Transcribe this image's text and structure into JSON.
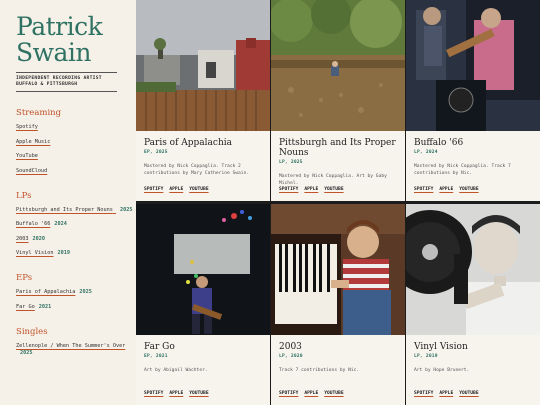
{
  "artist": {
    "name_line1": "Patrick",
    "name_line2": "Swain",
    "tagline_line1": "INDEPENDENT RECORDING ARTIST",
    "tagline_line2": "BUFFALO & PITTSBURGH"
  },
  "sidebar": {
    "streaming": {
      "heading": "Streaming",
      "links": [
        "Spotify",
        "Apple Music",
        "YouTube",
        "SoundCloud"
      ]
    },
    "lps": {
      "heading": "LPs",
      "items": [
        {
          "title": "Pittsburgh and Its Proper Nouns",
          "year": "2025"
        },
        {
          "title": "Buffalo '66",
          "year": "2024"
        },
        {
          "title": "2003",
          "year": "2020"
        },
        {
          "title": "Vinyl Vision",
          "year": "2019"
        }
      ]
    },
    "eps": {
      "heading": "EPs",
      "items": [
        {
          "title": "Paris of Appalachia",
          "year": "2025"
        },
        {
          "title": "Far Go",
          "year": "2021"
        }
      ]
    },
    "singles": {
      "heading": "Singles",
      "items": [
        {
          "title": "Zellenople / When The Summer's Over",
          "year": "2025"
        }
      ]
    }
  },
  "cards": [
    {
      "title": "Paris of Appalachia",
      "meta": "EP, 2025",
      "desc": "Mastered by Nick Coppaglia. Track 2 contributions by Mary Catherine Swain.",
      "links": [
        "SPOTIFY",
        "APPLE",
        "YOUTUBE"
      ]
    },
    {
      "title": "Pittsburgh and Its Proper Nouns",
      "meta": "LP, 2025",
      "desc": "Mastered by Nick Coppaglia. Art by Gaby Michel.",
      "links": [
        "SPOTIFY",
        "APPLE",
        "YOUTUBE"
      ]
    },
    {
      "title": "Buffalo '66",
      "meta": "LP, 2024",
      "desc": "Mastered by Nick Coppaglia. Track 7 contributions by Nic.",
      "links": [
        "SPOTIFY",
        "APPLE",
        "YOUTUBE"
      ]
    },
    {
      "title": "Far Go",
      "meta": "EP, 2021",
      "desc": "Art by Abigail Wachter.",
      "links": [
        "SPOTIFY",
        "APPLE",
        "YOUTUBE"
      ]
    },
    {
      "title": "2003",
      "meta": "LP, 2020",
      "desc": "Track 7 contributions by Nic.",
      "links": [
        "SPOTIFY",
        "APPLE",
        "YOUTUBE"
      ]
    },
    {
      "title": "Vinyl Vision",
      "meta": "LP, 2019",
      "desc": "Art by Hope Brunert.",
      "links": [
        "SPOTIFY",
        "APPLE",
        "YOUTUBE"
      ]
    }
  ]
}
